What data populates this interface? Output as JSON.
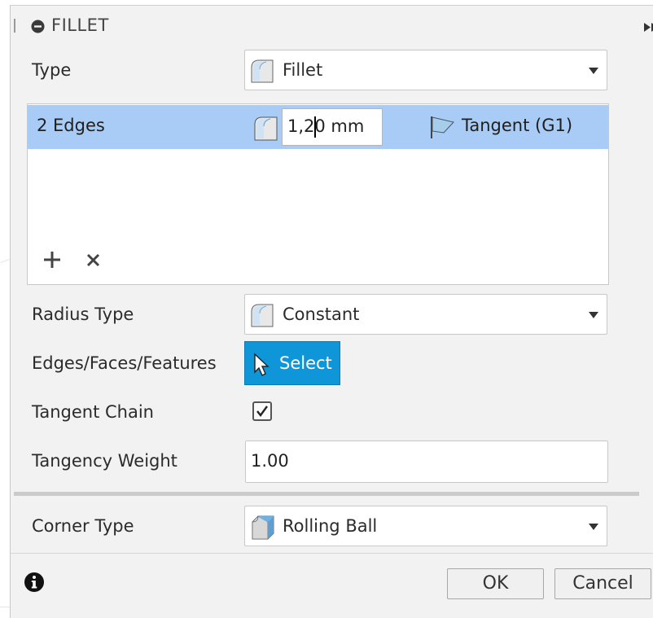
{
  "dialog": {
    "title": "FILLET"
  },
  "type_row": {
    "label": "Type",
    "value": "Fillet"
  },
  "edges": {
    "selection_label": "2 Edges",
    "radius_value": "1,20 mm",
    "continuity": "Tangent (G1)"
  },
  "radius_type_row": {
    "label": "Radius Type",
    "value": "Constant"
  },
  "edges_row": {
    "label": "Edges/Faces/Features",
    "button": "Select"
  },
  "tangent_chain_row": {
    "label": "Tangent Chain",
    "checked": true
  },
  "tangency_weight_row": {
    "label": "Tangency Weight",
    "value": "1.00"
  },
  "corner_type_row": {
    "label": "Corner Type",
    "value": "Rolling Ball"
  },
  "footer": {
    "ok": "OK",
    "cancel": "Cancel"
  },
  "colors": {
    "selection_highlight": "#a8ccf6",
    "select_button": "#0e96d8",
    "dialog_bg": "#f2f2f2"
  }
}
